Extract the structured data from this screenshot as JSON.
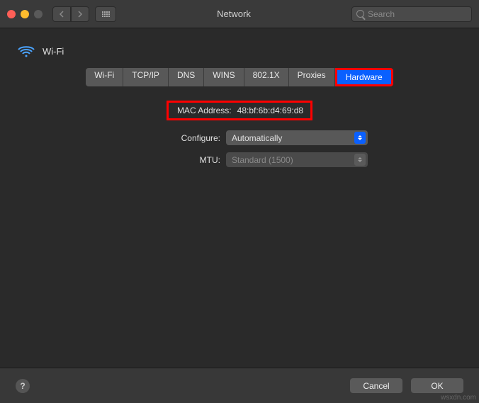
{
  "window": {
    "title": "Network"
  },
  "search": {
    "placeholder": "Search"
  },
  "header": {
    "name": "Wi-Fi"
  },
  "tabs": [
    "Wi-Fi",
    "TCP/IP",
    "DNS",
    "WINS",
    "802.1X",
    "Proxies",
    "Hardware"
  ],
  "active_tab_index": 6,
  "fields": {
    "mac": {
      "label": "MAC Address:",
      "value": "48:bf:6b:d4:69:d8"
    },
    "configure": {
      "label": "Configure:",
      "value": "Automatically"
    },
    "mtu": {
      "label": "MTU:",
      "value": "Standard (1500)"
    }
  },
  "footer": {
    "help": "?",
    "cancel": "Cancel",
    "ok": "OK"
  },
  "watermark": "wsxdn.com"
}
